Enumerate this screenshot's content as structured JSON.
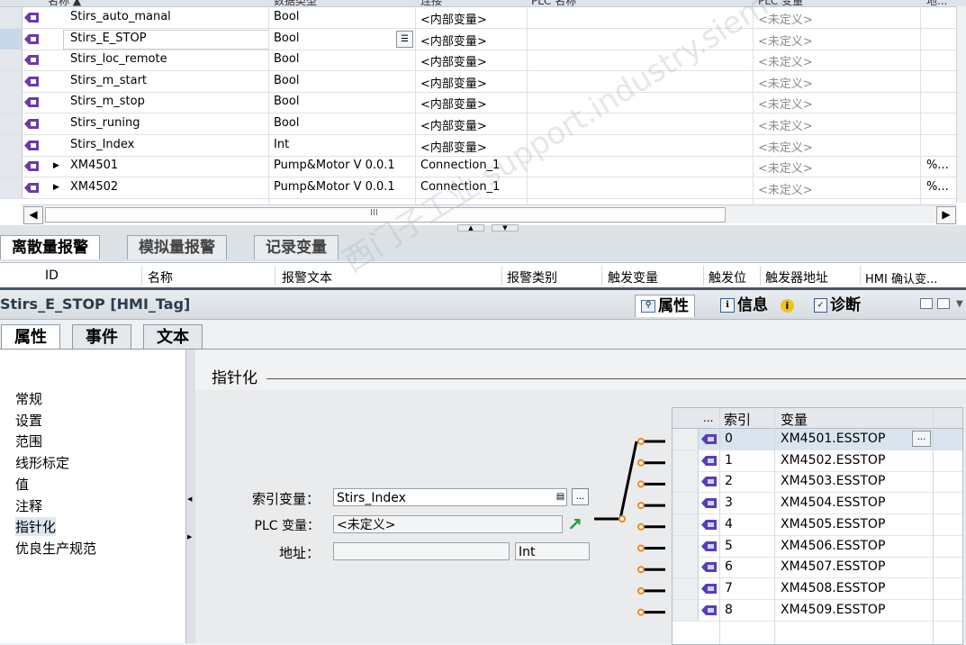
{
  "tag_table": {
    "headers": [
      "名称 ▲",
      "数据类型",
      "连接",
      "PLC 名称",
      "PLC 变量",
      "地..."
    ],
    "rows": [
      {
        "name": "Stirs_auto_manal",
        "type": "Bool",
        "connection": "<内部变量>",
        "plc_var": "<未定义>",
        "addr": ""
      },
      {
        "name": "Stirs_E_STOP",
        "type": "Bool",
        "connection": "<内部变量>",
        "plc_var": "<未定义>",
        "addr": ""
      },
      {
        "name": "Stirs_loc_remote",
        "type": "Bool",
        "connection": "<内部变量>",
        "plc_var": "<未定义>",
        "addr": ""
      },
      {
        "name": "Stirs_m_start",
        "type": "Bool",
        "connection": "<内部变量>",
        "plc_var": "<未定义>",
        "addr": ""
      },
      {
        "name": "Stirs_m_stop",
        "type": "Bool",
        "connection": "<内部变量>",
        "plc_var": "<未定义>",
        "addr": ""
      },
      {
        "name": "Stirs_runing",
        "type": "Bool",
        "connection": "<内部变量>",
        "plc_var": "<未定义>",
        "addr": ""
      },
      {
        "name": "Stirs_Index",
        "type": "Int",
        "connection": "<内部变量>",
        "plc_var": "<未定义>",
        "addr": ""
      },
      {
        "name": "XM4501",
        "type": "Pump&Motor V 0.0.1",
        "connection": "Connection_1",
        "plc_var": "<未定义>",
        "addr": "%..."
      },
      {
        "name": "XM4502",
        "type": "Pump&Motor V 0.0.1",
        "connection": "Connection_1",
        "plc_var": "<未定义>",
        "addr": "%..."
      }
    ],
    "scroll_center_glyph": "III"
  },
  "alarm_tabs": [
    "离散量报警",
    "模拟量报警",
    "记录变量"
  ],
  "alarm_headers": [
    "ID",
    "名称",
    "报警文本",
    "报警类别",
    "触发变量",
    "触发位",
    "触发器地址",
    "HMI 确认变..."
  ],
  "inspector": {
    "title": "Stirs_E_STOP [HMI_Tag]",
    "tabs": [
      "属性",
      "信息",
      "诊断"
    ],
    "info_badge": "i",
    "subtabs": [
      "属性",
      "事件",
      "文本"
    ]
  },
  "left_nav": [
    "常规",
    "设置",
    "范围",
    "线形标定",
    "值",
    "注释",
    "指针化",
    "优良生产规范"
  ],
  "pointer": {
    "section_title": "指针化",
    "index_label": "索引变量：",
    "index_value": "Stirs_Index",
    "plc_label": "PLC 变量：",
    "plc_value": "<未定义>",
    "addr_label": "地址：",
    "addr_value": "",
    "addr_type": "Int"
  },
  "index_table": {
    "headers": [
      "...",
      "索引",
      "变量"
    ],
    "rows": [
      {
        "index": "0",
        "var": "XM4501.ESSTOP"
      },
      {
        "index": "1",
        "var": "XM4502.ESSTOP"
      },
      {
        "index": "2",
        "var": "XM4503.ESSTOP"
      },
      {
        "index": "3",
        "var": "XM4504.ESSTOP"
      },
      {
        "index": "4",
        "var": "XM4505.ESSTOP"
      },
      {
        "index": "5",
        "var": "XM4506.ESSTOP"
      },
      {
        "index": "6",
        "var": "XM4507.ESSTOP"
      },
      {
        "index": "7",
        "var": "XM4508.ESSTOP"
      },
      {
        "index": "8",
        "var": "XM4509.ESSTOP"
      }
    ],
    "edit_button": "..."
  },
  "watermark": "西门子工业 support.industry.siemens.com/cs",
  "colors": {
    "accent": "#e8891d",
    "selection": "#d9e4ef",
    "dark_separator": "#4b5661",
    "plc_arrow": "#1f9a3a"
  }
}
